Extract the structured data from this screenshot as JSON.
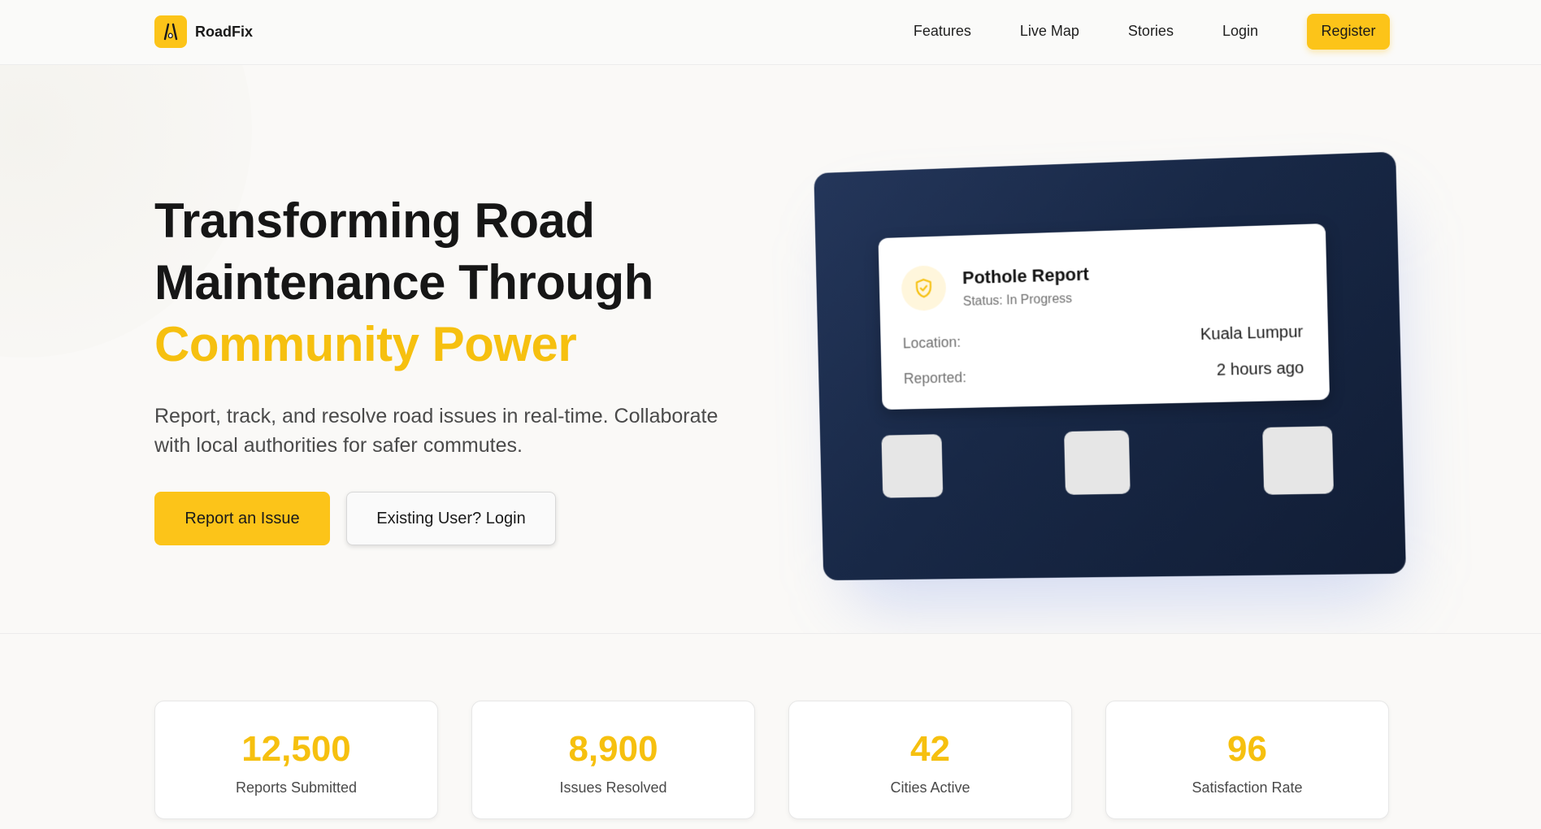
{
  "brand": {
    "name": "RoadFix",
    "accent_color": "#fcc419",
    "logo_icon": "road-icon"
  },
  "nav": {
    "items": [
      {
        "label": "Features"
      },
      {
        "label": "Live Map"
      },
      {
        "label": "Stories"
      },
      {
        "label": "Login"
      }
    ],
    "register_label": "Register"
  },
  "hero": {
    "title_line1": "Transforming Road",
    "title_line2": "Maintenance Through",
    "title_accent": "Community Power",
    "subtitle": "Report, track, and resolve road issues in real-time. Collaborate with local authorities for safer commutes.",
    "primary_button": "Report an Issue",
    "secondary_button": "Existing User? Login"
  },
  "report_card": {
    "icon": "shield-check-icon",
    "title": "Pothole Report",
    "status": "Status: In Progress",
    "location_label": "Location:",
    "location_value": "Kuala Lumpur",
    "reported_label": "Reported:",
    "reported_value": "2 hours ago"
  },
  "stats": [
    {
      "value": "12,500",
      "label": "Reports Submitted"
    },
    {
      "value": "8,900",
      "label": "Issues Resolved"
    },
    {
      "value": "42",
      "label": "Cities Active"
    },
    {
      "value": "96",
      "label": "Satisfaction Rate"
    }
  ]
}
